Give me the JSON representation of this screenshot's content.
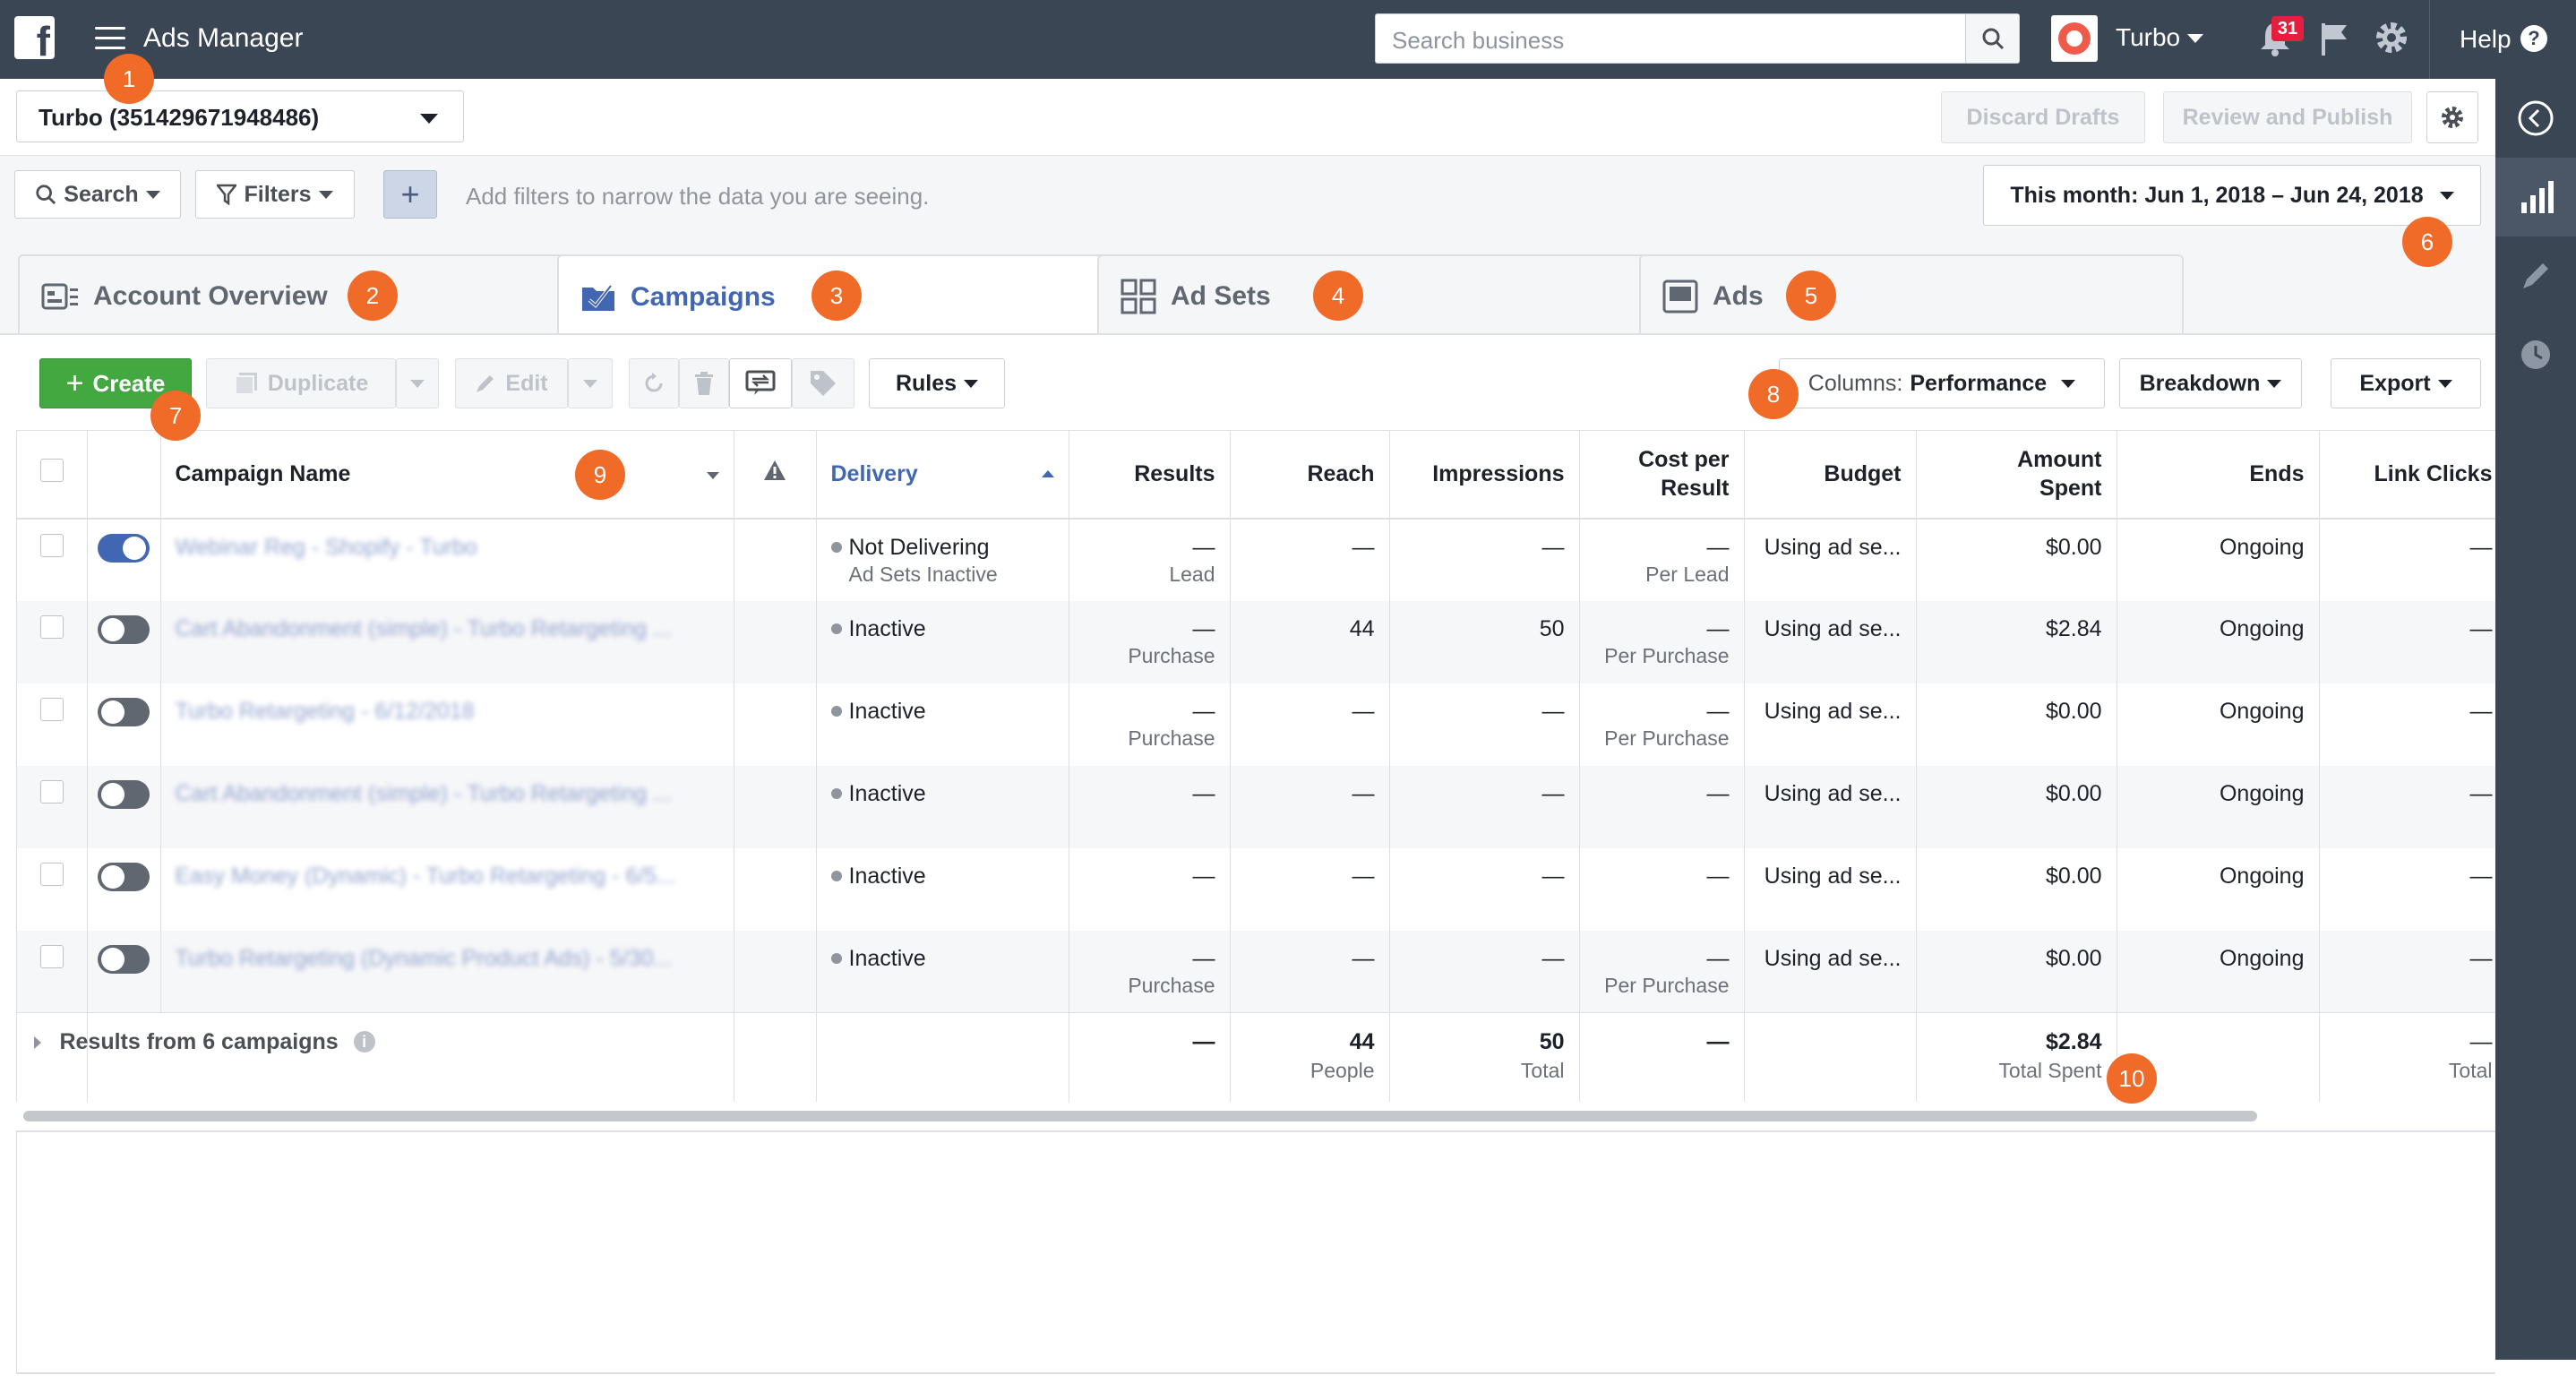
{
  "topbar": {
    "logo": "f",
    "app_title": "Ads Manager",
    "search_placeholder": "Search business",
    "account_name": "Turbo",
    "notification_count": "31",
    "help_label": "Help",
    "help_icon": "?"
  },
  "account_row": {
    "account_select": "Turbo (351429671948486)",
    "discard_label": "Discard Drafts",
    "review_label": "Review and Publish"
  },
  "filter_row": {
    "search_label": "Search",
    "filters_label": "Filters",
    "add_label": "+",
    "hint": "Add filters to narrow the data you are seeing.",
    "date_range": "This month: Jun 1, 2018 – Jun 24, 2018"
  },
  "tabs": [
    {
      "label": "Account Overview",
      "icon": "overview-icon"
    },
    {
      "label": "Campaigns",
      "icon": "folder-check-icon"
    },
    {
      "label": "Ad Sets",
      "icon": "grid-icon"
    },
    {
      "label": "Ads",
      "icon": "ad-icon"
    }
  ],
  "toolbar": {
    "create_label": "Create",
    "duplicate_label": "Duplicate",
    "edit_label": "Edit",
    "rules_label": "Rules",
    "columns_prefix": "Columns:",
    "columns_value": "Performance",
    "breakdown_label": "Breakdown",
    "export_label": "Export"
  },
  "table": {
    "headers": {
      "campaign_name": "Campaign Name",
      "delivery": "Delivery",
      "results": "Results",
      "reach": "Reach",
      "impressions": "Impressions",
      "cost_per_result_line1": "Cost per",
      "cost_per_result_line2": "Result",
      "budget": "Budget",
      "amount_spent_line1": "Amount",
      "amount_spent_line2": "Spent",
      "ends": "Ends",
      "link_clicks": "Link Clicks"
    },
    "rows": [
      {
        "on": true,
        "name": "Webinar Reg - Shopify - Turbo",
        "delivery": "Not Delivering",
        "delivery_sub": "Ad Sets Inactive",
        "results": "—",
        "results_sub": "Lead",
        "reach": "—",
        "impressions": "—",
        "cpr": "—",
        "cpr_sub": "Per Lead",
        "budget": "Using ad se...",
        "spent": "$0.00",
        "ends": "Ongoing",
        "clicks": "—"
      },
      {
        "on": false,
        "name": "Cart Abandonment (simple) - Turbo Retargeting ...",
        "delivery": "Inactive",
        "delivery_sub": "",
        "results": "—",
        "results_sub": "Purchase",
        "reach": "44",
        "impressions": "50",
        "cpr": "—",
        "cpr_sub": "Per Purchase",
        "budget": "Using ad se...",
        "spent": "$2.84",
        "ends": "Ongoing",
        "clicks": "—"
      },
      {
        "on": false,
        "name": "Turbo Retargeting - 6/12/2018",
        "delivery": "Inactive",
        "delivery_sub": "",
        "results": "—",
        "results_sub": "Purchase",
        "reach": "—",
        "impressions": "—",
        "cpr": "—",
        "cpr_sub": "Per Purchase",
        "budget": "Using ad se...",
        "spent": "$0.00",
        "ends": "Ongoing",
        "clicks": "—"
      },
      {
        "on": false,
        "name": "Cart Abandonment (simple) - Turbo Retargeting ...",
        "delivery": "Inactive",
        "delivery_sub": "",
        "results": "—",
        "results_sub": "",
        "reach": "—",
        "impressions": "—",
        "cpr": "—",
        "cpr_sub": "",
        "budget": "Using ad se...",
        "spent": "$0.00",
        "ends": "Ongoing",
        "clicks": "—"
      },
      {
        "on": false,
        "name": "Easy Money (Dynamic) - Turbo Retargeting - 6/5...",
        "delivery": "Inactive",
        "delivery_sub": "",
        "results": "—",
        "results_sub": "",
        "reach": "—",
        "impressions": "—",
        "cpr": "—",
        "cpr_sub": "",
        "budget": "Using ad se...",
        "spent": "$0.00",
        "ends": "Ongoing",
        "clicks": "—"
      },
      {
        "on": false,
        "name": "Turbo Retargeting (Dynamic Product Ads) - 5/30...",
        "delivery": "Inactive",
        "delivery_sub": "",
        "results": "—",
        "results_sub": "Purchase",
        "reach": "—",
        "impressions": "—",
        "cpr": "—",
        "cpr_sub": "Per Purchase",
        "budget": "Using ad se...",
        "spent": "$0.00",
        "ends": "Ongoing",
        "clicks": "—"
      }
    ],
    "footer": {
      "label": "Results from 6 campaigns",
      "results": "—",
      "reach": "44",
      "reach_sub": "People",
      "impressions": "50",
      "impressions_sub": "Total",
      "cpr": "—",
      "spent": "$2.84",
      "spent_sub": "Total Spent",
      "clicks": "—",
      "clicks_sub": "Total"
    }
  },
  "markers": [
    "1",
    "2",
    "3",
    "4",
    "5",
    "6",
    "7",
    "8",
    "9",
    "10"
  ],
  "colors": {
    "topbar": "#3b4654",
    "accent_blue": "#4267b2",
    "create_green": "#42a83f",
    "marker_orange": "#f06a28",
    "notification_red": "#e41e3f"
  }
}
